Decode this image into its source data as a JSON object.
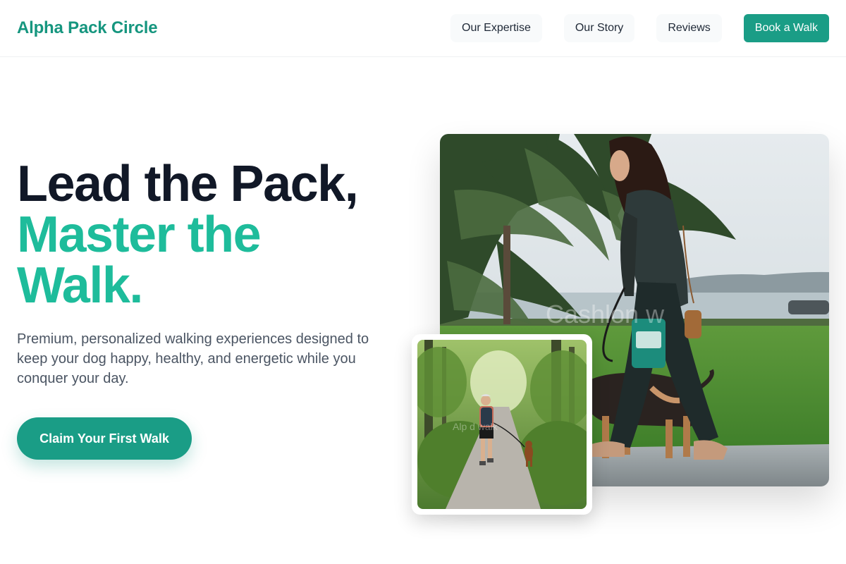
{
  "brand": {
    "name": "Alpha Pack Circle",
    "accent": "#1a9d86",
    "highlight": "#1ebc9b"
  },
  "nav": {
    "items": [
      {
        "label": "Our Expertise"
      },
      {
        "label": "Our Story"
      },
      {
        "label": "Reviews"
      }
    ],
    "cta_label": "Book a Walk"
  },
  "hero": {
    "headline_line1": "Lead the Pack,",
    "headline_line2": "Master the",
    "headline_line3": "Walk.",
    "subtext": "Premium, personalized walking experiences designed to keep your dog happy, healthy, and energetic while you conquer your day.",
    "cta_label": "Claim Your First Walk"
  },
  "images": {
    "main_watermark": "Cashlon   w",
    "inset_watermark": "Alp    d walk"
  }
}
